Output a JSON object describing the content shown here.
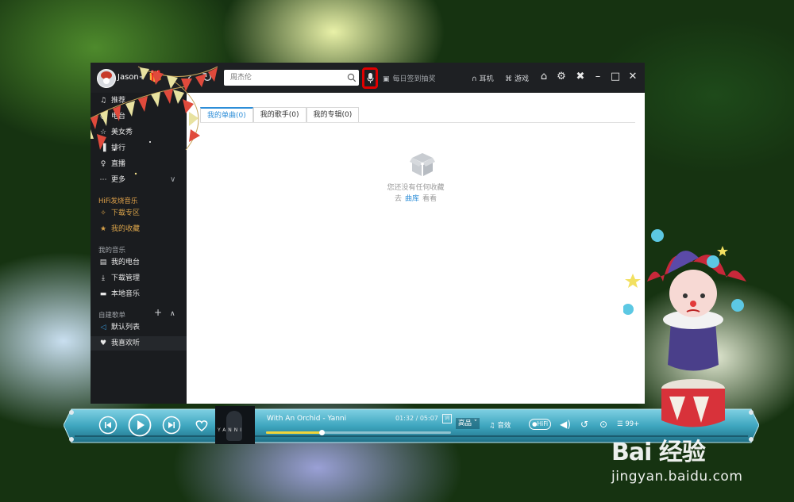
{
  "header": {
    "username": "Jason+",
    "search_placeholder": "周杰伦",
    "signin_label": "每日签到抽奖",
    "earphone_label": "耳机",
    "game_label": "游戏"
  },
  "sidebar": {
    "items": [
      {
        "label": "推荐",
        "icon": "music-note-icon"
      },
      {
        "label": "电台",
        "icon": "radio-icon"
      },
      {
        "label": "美女秀",
        "icon": "star-icon"
      },
      {
        "label": "排行",
        "icon": "bar-chart-icon"
      },
      {
        "label": "直播",
        "icon": "mic-icon"
      },
      {
        "label": "更多",
        "icon": "more-icon"
      }
    ],
    "hifi_heading": "HiFi发烧音乐",
    "hifi_items": [
      {
        "label": "下载专区"
      },
      {
        "label": "我的收藏"
      }
    ],
    "mymusic_heading": "我的音乐",
    "mymusic_items": [
      {
        "label": "我的电台"
      },
      {
        "label": "下载管理"
      },
      {
        "label": "本地音乐"
      }
    ],
    "playlist_heading": "自建歌单",
    "playlist_items": [
      {
        "label": "默认列表"
      },
      {
        "label": "我喜欢听"
      }
    ]
  },
  "content": {
    "tabs": [
      {
        "label": "我的单曲(0)",
        "active": true
      },
      {
        "label": "我的歌手(0)",
        "active": false
      },
      {
        "label": "我的专辑(0)",
        "active": false
      }
    ],
    "empty_text": "您还没有任何收藏",
    "empty_prefix": "去",
    "empty_link": "曲库",
    "empty_suffix": "看看"
  },
  "player": {
    "song": "With An Orchid - Yanni",
    "time": "01:32 / 05:07",
    "lyric_label": "词",
    "progress": 0.3,
    "cover_text": "YANNI",
    "quality": "高品",
    "sound_effect_label": "音效",
    "hifi_label": "HiFi",
    "playlist_count": "99+"
  },
  "watermark": {
    "logo": "Bai 经验",
    "url": "jingyan.baidu.com"
  },
  "colors": {
    "accent": "#2d8ed8",
    "highlight_box": "#e00000",
    "progress_fill": "#f1d53a",
    "player_teal": "#3ea6bf"
  }
}
